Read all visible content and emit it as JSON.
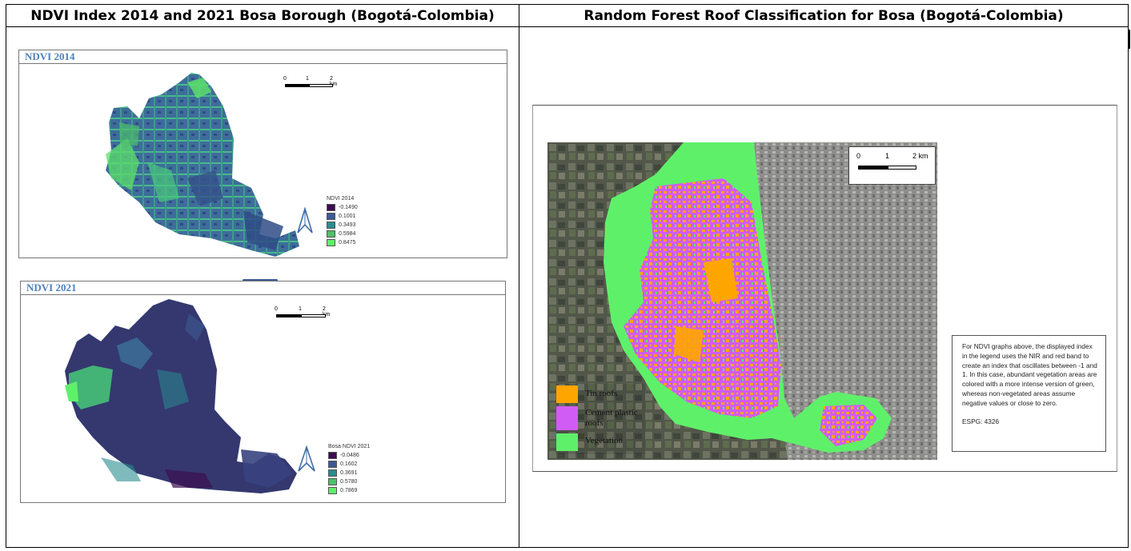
{
  "headers": {
    "left": "NDVI Index 2014 and 2021 Bosa Borough (Bogotá-Colombia)",
    "right": "Random Forest Roof Classification for Bosa (Bogotá-Colombia)"
  },
  "ndvi_2014": {
    "title": "NDVI 2014",
    "scale": {
      "zero": "0",
      "one": "1",
      "two": "2 km"
    },
    "legend_title": "NDVI 2014",
    "legend": [
      {
        "value": "-0.1490",
        "color": "#3b0f4f"
      },
      {
        "value": "0.1001",
        "color": "#3e5a93"
      },
      {
        "value": "0.3493",
        "color": "#2a8c8f"
      },
      {
        "value": "0.5984",
        "color": "#4cbf6a"
      },
      {
        "value": "0.8475",
        "color": "#5ff06a"
      }
    ]
  },
  "ndvi_2021": {
    "title": "NDVI 2021",
    "scale": {
      "zero": "0",
      "one": "1",
      "two": "2 km"
    },
    "legend_title": "Bosa NDVI 2021",
    "legend": [
      {
        "value": "-0.0486",
        "color": "#3b0f4f"
      },
      {
        "value": "0.1602",
        "color": "#3e5a93"
      },
      {
        "value": "0.3691",
        "color": "#2a8c8f"
      },
      {
        "value": "0.5780",
        "color": "#4cbf6a"
      },
      {
        "value": "0.7869",
        "color": "#5ff06a"
      }
    ]
  },
  "rf_map": {
    "scale": {
      "zero": "0",
      "one": "1",
      "two": "2 km"
    },
    "legend": [
      {
        "label": "Tin roofs",
        "color": "#ffa500"
      },
      {
        "label": "Cement plastic roofs",
        "color": "#d15cf5"
      },
      {
        "label": "Vegetation",
        "color": "#5ff06a"
      }
    ]
  },
  "note": {
    "text": "For NDVI graphs above, the displayed index in the legend uses the NIR and red band to create an index that oscillates between -1 and 1.  In this case, abundant vegetation areas are colored with a more intense version of green, whereas non-vegetated areas assume negative values or close to zero.",
    "epsg": "ESPG: 4326"
  }
}
